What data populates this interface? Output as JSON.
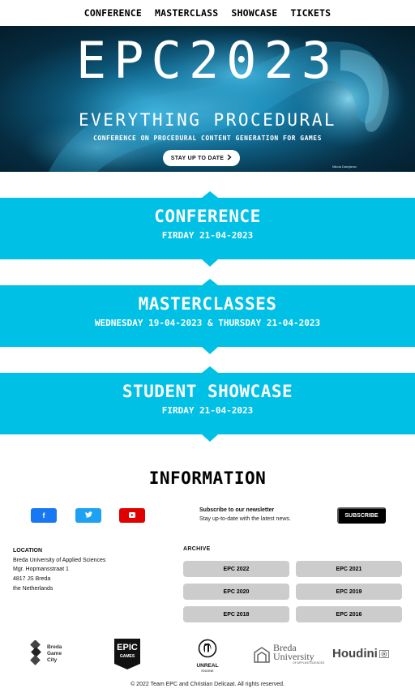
{
  "nav": {
    "items": [
      {
        "label": "CONFERENCE"
      },
      {
        "label": "MASTERCLASS"
      },
      {
        "label": "SHOWCASE"
      },
      {
        "label": "TICKETS"
      }
    ]
  },
  "hero": {
    "title": "EPC2023",
    "subtitle": "EVERYTHING PROCEDURAL",
    "tagline": "CONFERENCE ON PROCEDURAL CONTENT GENERATION FOR GAMES",
    "button_label": "STAY UP TO DATE",
    "button_icon": "chevron-right-icon",
    "credit": "Nikola Damjanov"
  },
  "events": [
    {
      "title": "CONFERENCE",
      "date": "FIRDAY 21-04-2023"
    },
    {
      "title": "MASTERCLASSES",
      "date": "WEDNESDAY 19-04-2023 & THURSDAY 21-04-2023"
    },
    {
      "title": "STUDENT SHOWCASE",
      "date": "FIRDAY 21-04-2023"
    }
  ],
  "information": {
    "title": "INFORMATION",
    "social": [
      {
        "icon": "facebook-icon",
        "glyph": "f",
        "color": "#1877f2"
      },
      {
        "icon": "twitter-icon",
        "glyph": "🐦",
        "color": "#1da1f2"
      },
      {
        "icon": "youtube-icon",
        "glyph": "▶",
        "color": "#e00000"
      }
    ],
    "newsletter": {
      "title": "Subscribe to our newsletter",
      "subtitle": "Stay up-to-date with the latest news.",
      "button_label": "SUBSCRIBE"
    },
    "location": {
      "title": "LOCATION",
      "lines": [
        "Breda University of Applied Sciences",
        "Mgr. Hopmansstraat 1",
        "4817 JS Breda",
        "the Netherlands"
      ]
    },
    "archive": {
      "title": "ARCHIVE",
      "items": [
        {
          "label": "EPC 2022"
        },
        {
          "label": "EPC 2021"
        },
        {
          "label": "EPC 2020"
        },
        {
          "label": "EPC 2019"
        },
        {
          "label": "EPC 2018"
        },
        {
          "label": "EPC 2016"
        }
      ]
    }
  },
  "logos": {
    "breda_game_city": {
      "line1": "Breda",
      "line2": "Game",
      "line3": "City"
    },
    "epic_games": {
      "line1": "EPIC",
      "line2": "GAMES"
    },
    "unreal_engine": {
      "line1": "UNREAL",
      "line2": "ENGINE"
    },
    "breda_university": {
      "line1": "Breda",
      "line2": "University",
      "line3": "OF APPLIED SCIENCES"
    },
    "houdini": {
      "text": "Houdini"
    }
  },
  "footer": {
    "copyright": "© 2022 Team EPC and Christian Delicaat. All rights reserved."
  },
  "colors": {
    "accent": "#00c0e6",
    "archive_button": "#cccccc",
    "subscribe_button": "#000000"
  }
}
